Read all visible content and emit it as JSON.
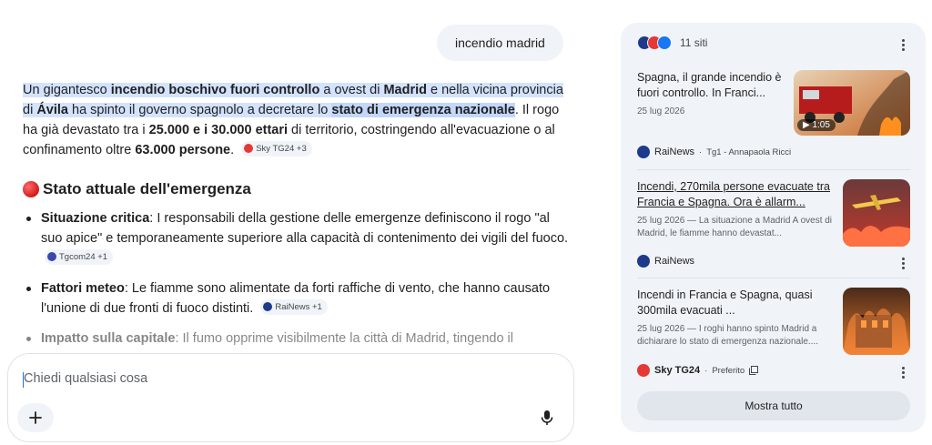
{
  "user_query": "incendio madrid",
  "answer": {
    "p1": {
      "t1": "Un gigantesco ",
      "b1": "incendio boschivo fuori controllo",
      "t2": " a ovest di ",
      "b2": "Madrid",
      "t3": " e nella vicina provincia di ",
      "b3": "Ávila",
      "t4": " ha spinto il governo spagnolo a decretare lo ",
      "b4": "stato di emergenza nazionale",
      "t5": ". Il rogo ha già devastato tra i ",
      "b5": "25.000 e i 30.000 ettari",
      "t6": " di territorio, costringendo all'evacuazione o al confinamento oltre ",
      "b6": "63.000 persone",
      "t7": ".",
      "chip": "Sky TG24 +3"
    },
    "heading": "Stato attuale dell'emergenza",
    "bullets": [
      {
        "bold": "Situazione critica",
        "text": ": I responsabili della gestione delle emergenze definiscono il rogo \"al suo apice\" e temporaneamente superiore alla capacità di contenimento dei vigili del fuoco.",
        "chip": "Tgcom24 +1"
      },
      {
        "bold": "Fattori meteo",
        "text": ": Le fiamme sono alimentate da forti raffiche di vento, che hanno causato l'unione di due fronti di fuoco distinti.",
        "chip": "RaiNews +1"
      },
      {
        "bold": "Impatto sulla capitale",
        "text": ": Il fumo opprime visibilmente la città di Madrid, tingendo il"
      }
    ]
  },
  "input": {
    "placeholder": "Chiedi qualsiasi cosa"
  },
  "sources": {
    "count_label": "11 siti",
    "cards": [
      {
        "title": "Spagna, il grande incendio è fuori controllo. In Franci...",
        "meta": "25 lug 2026",
        "duration": "1:05",
        "source": "RaiNews",
        "sub": "Tg1 - Annapaola Ricci"
      },
      {
        "title": "Incendi, 270mila persone evacuate tra Francia e Spagna. Ora è allarm...",
        "meta": "25 lug 2026 — La situazione a Madrid A ovest di Madrid, le fiamme hanno devastat...",
        "source": "RaiNews"
      },
      {
        "title": "Incendi in Francia e Spagna, quasi 300mila evacuati ...",
        "meta": "25 lug 2026 — I roghi hanno spinto Madrid a dichiarare lo stato di emergenza nazionale....",
        "source": "Sky TG24",
        "sub": "Preferito"
      }
    ],
    "show_all": "Mostra tutto"
  },
  "colors": {
    "accent": "#1a73e8",
    "panel_bg": "#f0f4f9",
    "highlight": "#d3e3fd"
  }
}
